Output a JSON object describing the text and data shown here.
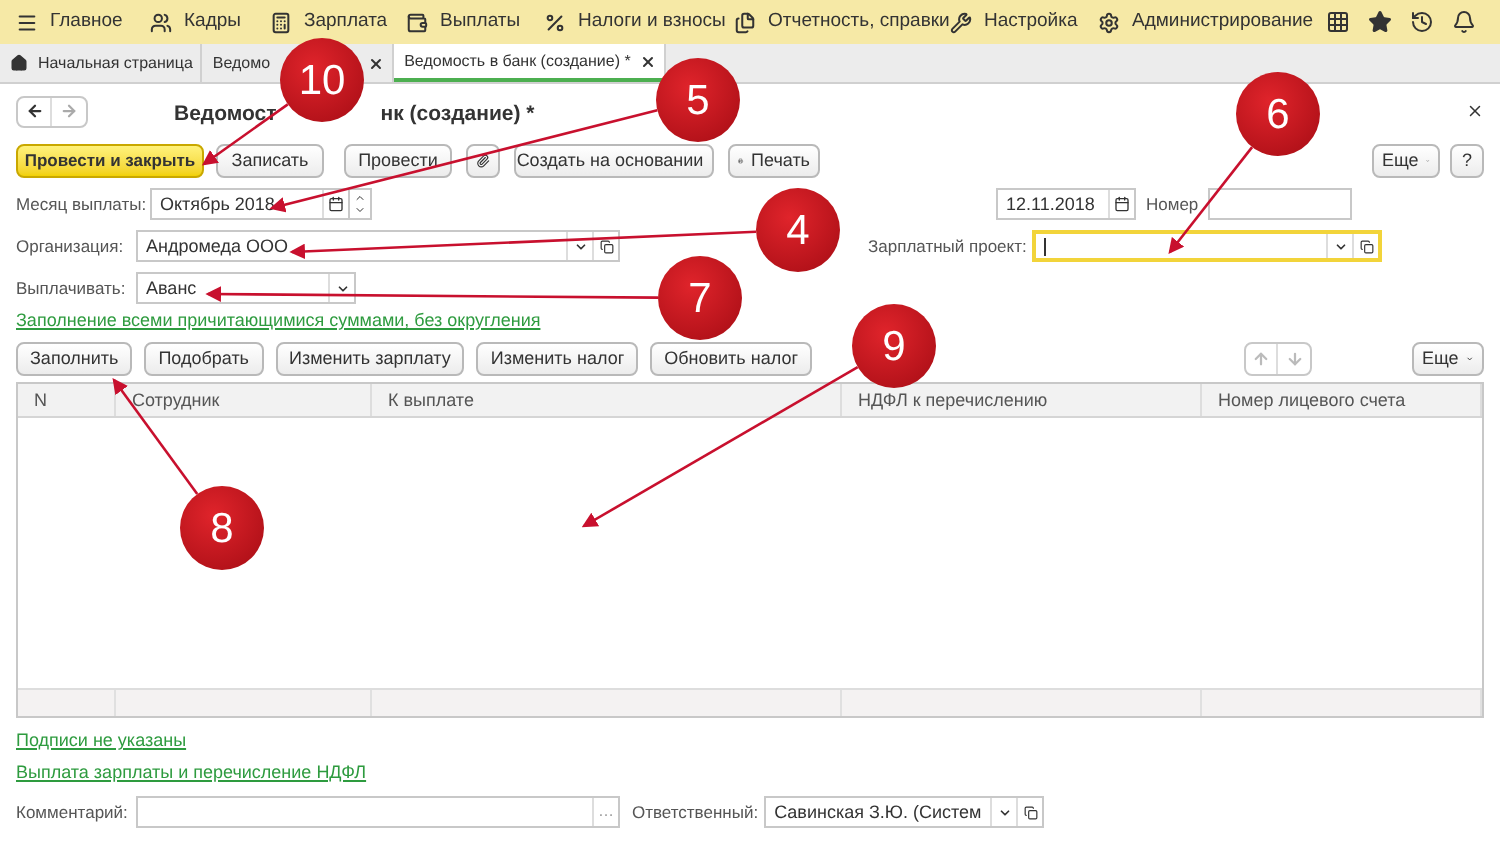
{
  "menu": [
    {
      "label": "Главное"
    },
    {
      "label": "Кадры"
    },
    {
      "label": "Зарплата"
    },
    {
      "label": "Выплаты"
    },
    {
      "label": "Налоги и взносы"
    },
    {
      "label": "Отчетность, справки"
    },
    {
      "label": "Настройка"
    },
    {
      "label": "Администрирование"
    }
  ],
  "tabs": [
    {
      "label": "Начальная страница",
      "kind": "home",
      "selected": false
    },
    {
      "label": "Ведомо",
      "kind": "doc",
      "selected": false
    },
    {
      "label": "Ведомость в банк (создание) *",
      "kind": "doc",
      "selected": true
    }
  ],
  "form": {
    "title": [
      "Ведомост",
      "нк (создание) *"
    ],
    "toolbar": [
      {
        "label": "Провести и закрыть",
        "kind": "primary"
      },
      {
        "label": "Записать",
        "kind": "plain"
      },
      {
        "label": "Провести",
        "kind": "plain"
      },
      {
        "kind": "clip"
      },
      {
        "label": "Создать на основании",
        "kind": "dropdown"
      },
      {
        "label": "Печать",
        "kind": "print"
      }
    ],
    "more": "Еще",
    "help": "?",
    "month": {
      "label": "Месяц выплаты:",
      "value": "Октябрь 2018"
    },
    "date": {
      "value": "12.11.2018"
    },
    "number": {
      "label": "Номер"
    },
    "org": {
      "label": "Организация:",
      "value": "Андромеда ООО"
    },
    "project": {
      "label": "Зарплатный проект:",
      "focused": true
    },
    "pay": {
      "label": "Выплачивать:",
      "value": "Аванс"
    },
    "fill_link": "Заполнение всеми причитающимися суммами, без округления",
    "table_buttons": [
      "Заполнить",
      "Подобрать",
      "Изменить зарплату",
      "Изменить налог",
      "Обновить налог"
    ],
    "table_more": "Еще",
    "columns": [
      "N",
      "Сотрудник",
      "К выплате",
      "НДФЛ к перечислению",
      "Номер лицевого счета"
    ],
    "links": [
      "Подписи не указаны",
      "Выплата зарплаты и перечисление НДФЛ"
    ],
    "comment": {
      "label": "Комментарий:",
      "select_button": "…"
    },
    "responsible": {
      "label": "Ответственный:",
      "value": "Савинская З.Ю. (Систем"
    }
  },
  "callouts": [
    {
      "label": "10"
    },
    {
      "label": "5"
    },
    {
      "label": "6"
    },
    {
      "label": "4"
    },
    {
      "label": "7"
    },
    {
      "label": "9"
    },
    {
      "label": "8"
    }
  ]
}
